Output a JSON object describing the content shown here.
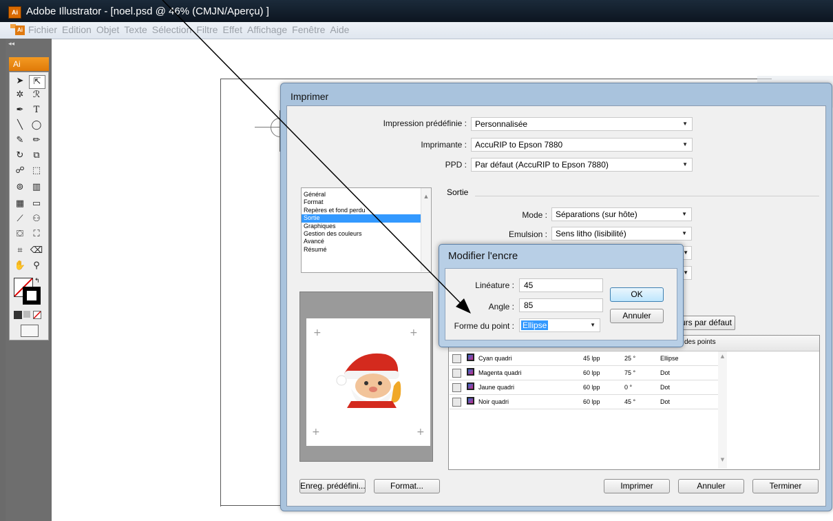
{
  "window": {
    "app_icon": "Ai",
    "title": "Adobe Illustrator - [noel.psd @ 46% (CMJN/Aperçu) ]"
  },
  "menubar": {
    "icon": "Ai",
    "items": [
      "Fichier",
      "Edition",
      "Objet",
      "Texte",
      "Sélection",
      "Filtre",
      "Effet",
      "Affichage",
      "Fenêtre",
      "Aide"
    ]
  },
  "tools": {
    "collapse": "◂◂",
    "header": "Ai"
  },
  "print_dialog": {
    "title": "Imprimer",
    "preset_label": "Impression prédéfinie :",
    "preset_value": "Personnalisée",
    "printer_label": "Imprimante :",
    "printer_value": "AccuRIP to Epson 7880",
    "ppd_label": "PPD :",
    "ppd_value": "Par défaut (AccuRIP to Epson 7880)",
    "categories": [
      "Général",
      "Format",
      "Repères et fond perdu",
      "Sortie",
      "Graphiques",
      "Gestion des couleurs",
      "Avancé",
      "Résumé"
    ],
    "selected_category": "Sortie",
    "section_title": "Sortie",
    "mode_label": "Mode :",
    "mode_value": "Séparations (sur hôte)",
    "emulsion_label": "Emulsion :",
    "emulsion_value": "Sens litho (lisibilité)",
    "defaults_button": "urs par défaut",
    "dot_column_header": "des points",
    "inks": [
      {
        "name": "Cyan quadri",
        "frequency": "45 lpp",
        "angle": "25 °",
        "dot": "Ellipse"
      },
      {
        "name": "Magenta quadri",
        "frequency": "60 lpp",
        "angle": "75 °",
        "dot": "Dot"
      },
      {
        "name": "Jaune quadri",
        "frequency": "60 lpp",
        "angle": "0 °",
        "dot": "Dot"
      },
      {
        "name": "Noir quadri",
        "frequency": "60 lpp",
        "angle": "45 °",
        "dot": "Dot"
      }
    ],
    "save_preset_button": "Enreg. prédéfini...",
    "format_button": "Format...",
    "print_button": "Imprimer",
    "cancel_button": "Annuler",
    "done_button": "Terminer"
  },
  "modify_ink": {
    "title": "Modifier l'encre",
    "lineature_label": "Linéature :",
    "lineature_value": "45",
    "angle_label": "Angle :",
    "angle_value": "85",
    "dot_shape_label": "Forme du point :",
    "dot_shape_value": "Ellipse",
    "ok_button": "OK",
    "cancel_button": "Annuler"
  },
  "colors": {
    "accent_orange": "#e07a08",
    "selection_blue": "#3399ff",
    "dialog_frame": "#a9c3dd"
  }
}
